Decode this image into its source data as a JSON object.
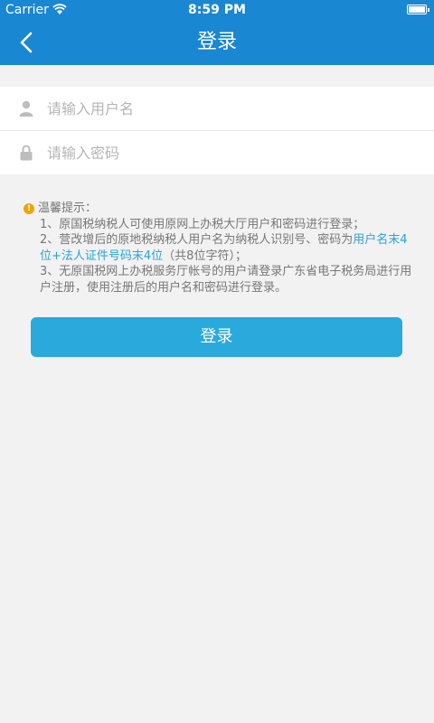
{
  "status": {
    "carrier": "Carrier",
    "time": "8:59 PM"
  },
  "nav": {
    "title": "登录",
    "back_icon": "chevron-left-icon"
  },
  "form": {
    "username_placeholder": "请输入用户名",
    "password_placeholder": "请输入密码"
  },
  "tips": {
    "heading": "温馨提示：",
    "line1": "1、原国税纳税人可使用原网上办税大厅用户和密码进行登录；",
    "line2_a": "2、营改增后的原地税纳税人用户名为纳税人识别号、密码为",
    "line2_highlight": "用户名末4位+法人证件号码末4位",
    "line2_b": "（共8位字符）；",
    "line3": "3、无原国税网上办税服务厅帐号的用户请登录广东省电子税务局进行用户注册，使用注册后的用户名和密码进行登录。"
  },
  "login_button": "登录",
  "colors": {
    "header": "#1a87d2",
    "button": "#2aa9dd",
    "highlight": "#29a3d9",
    "warning": "#f0a500"
  }
}
